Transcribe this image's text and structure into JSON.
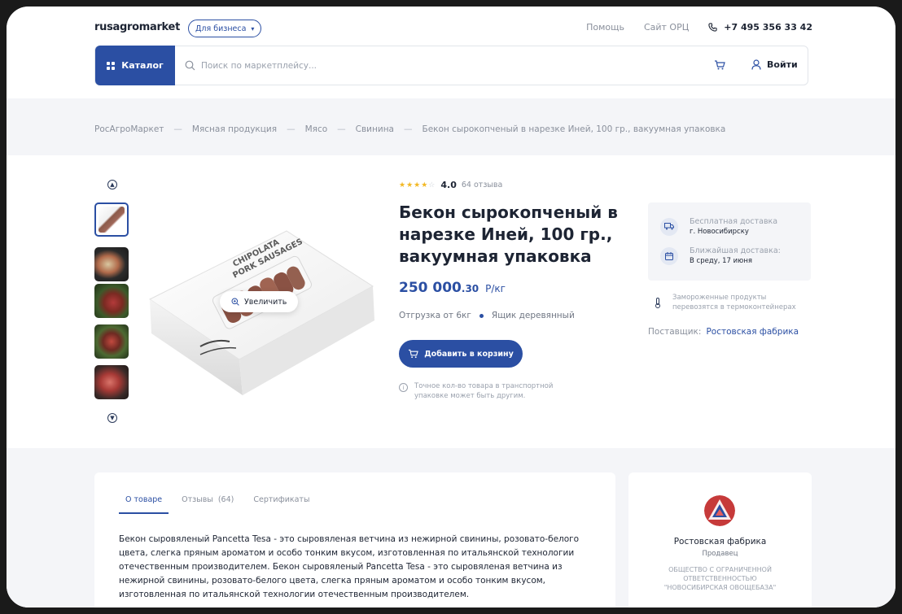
{
  "header": {
    "logo_text": "rusagromarket",
    "business_button": "Для бизнеса",
    "links": [
      "Помощь",
      "Сайт ОРЦ"
    ],
    "phone": "+7 495 356 33 42"
  },
  "search": {
    "catalog_label": "Каталог",
    "placeholder": "Поиск по маркетплейсу...",
    "login_label": "Войти"
  },
  "breadcrumb": [
    "РосАгроМаркет",
    "Мясная продукция",
    "Мясо",
    "Свинина",
    "Бекон сырокопченый в нарезке Иней, 100 гр., вакуумная упаковка"
  ],
  "breadcrumb_separator": "—",
  "gallery": {
    "zoom_label": "Увеличить",
    "box_text_line1": "CHIPOLATA",
    "box_text_line2": "PORK SAUSAGES"
  },
  "product": {
    "rating_value": "4.0",
    "rating_stars": 4,
    "reviews_count": "64 отзыва",
    "title": "Бекон сырокопченый в нарезке Иней, 100 гр., вакуумная упаковка",
    "price_main": "250 000",
    "price_cents": ".30",
    "price_unit": "Р/кг",
    "shipment": "Отгрузка от 6кг",
    "package": "Ящик деревянный",
    "add_to_cart": "Добавить в корзину",
    "note": "Точное кол-во товара в транспортной упаковке может быть другим."
  },
  "delivery": {
    "free_label": "Бесплатная доставка",
    "free_city": "г. Новосибирску",
    "nearest_label": "Ближайшая доставка:",
    "nearest_date": "В среду, 17 июня",
    "frozen_note": "Замороженные продукты перевозятся в термоконтейнерах",
    "supplier_label": "Поставщик:",
    "supplier_name": "Ростовская фабрика"
  },
  "tabs": [
    {
      "label": "О товаре"
    },
    {
      "label": "Отзывы  (64)"
    },
    {
      "label": "Сертификаты"
    }
  ],
  "description": "Бекон сыровяленый Pancetta Tesa - это сыровяленая ветчина из нежирной свинины, розовато-белого цвета, слегка пряным ароматом и особо тонким вкусом, изготовленная по итальянской технологии отечественным производителем. Бекон сыровяленый Pancetta Tesa - это сыровяленая ветчина из нежирной свинины, розовато-белого цвета, слегка пряным ароматом и особо тонким вкусом, изготовленная по итальянской технологии отечественным производителем.",
  "seller": {
    "name": "Ростовская фабрика",
    "role": "Продавец",
    "legal": "ОБЩЕСТВО С ОГРАНИЧЕННОЙ ОТВЕТСТВЕННОСТЬЮ \"НОВОСИБИРСКАЯ ОВОЩЕБАЗА\""
  },
  "colors": {
    "accent": "#2b4fa3",
    "star": "#f2b824",
    "logo_dot": "#3cb371"
  }
}
